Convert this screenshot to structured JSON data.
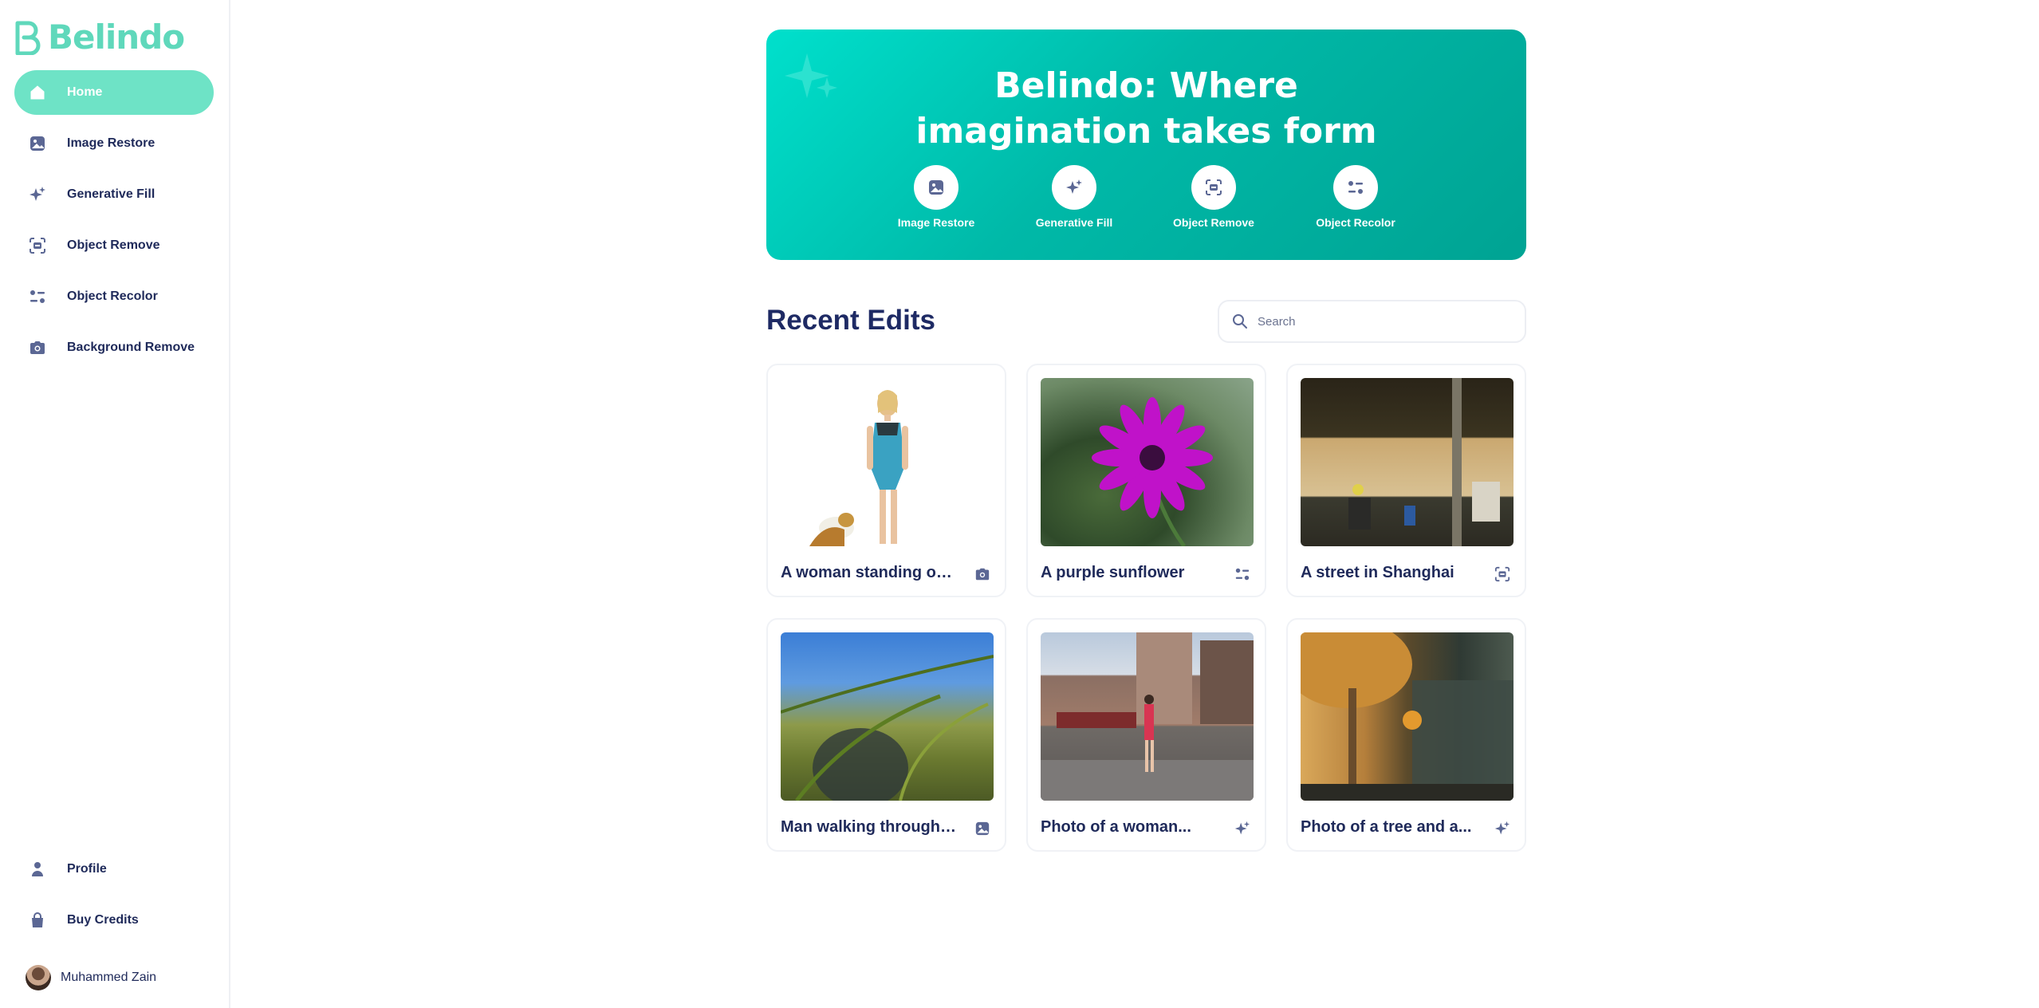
{
  "app": {
    "name": "Belindo",
    "brand_color": "#6ee3c6"
  },
  "sidebar": {
    "items": [
      {
        "label": "Home",
        "icon": "home-icon",
        "active": true
      },
      {
        "label": "Image Restore",
        "icon": "image-icon"
      },
      {
        "label": "Generative Fill",
        "icon": "sparkle-icon"
      },
      {
        "label": "Object Remove",
        "icon": "scan-icon"
      },
      {
        "label": "Object Recolor",
        "icon": "recolor-icon"
      },
      {
        "label": "Background Remove",
        "icon": "camera-icon"
      }
    ],
    "bottom_items": [
      {
        "label": "Profile",
        "icon": "user-icon"
      },
      {
        "label": "Buy Credits",
        "icon": "bag-icon"
      }
    ],
    "user": {
      "name": "Muhammed Zain"
    }
  },
  "hero": {
    "title_line1": "Belindo: Where",
    "title_line2": "imagination takes form",
    "actions": [
      {
        "label": "Image Restore",
        "icon": "image-icon"
      },
      {
        "label": "Generative Fill",
        "icon": "sparkle-icon"
      },
      {
        "label": "Object Remove",
        "icon": "scan-icon"
      },
      {
        "label": "Object Recolor",
        "icon": "recolor-icon"
      }
    ]
  },
  "recent": {
    "title": "Recent Edits",
    "search_placeholder": "Search",
    "cards": [
      {
        "title": "A woman standing on ...",
        "icon": "camera-icon"
      },
      {
        "title": "A purple sunflower",
        "icon": "recolor-icon"
      },
      {
        "title": "A street in Shanghai",
        "icon": "scan-icon"
      },
      {
        "title": "Man walking through t...",
        "icon": "image-icon"
      },
      {
        "title": "Photo of a woman...",
        "icon": "sparkle-icon"
      },
      {
        "title": "Photo of a tree and a...",
        "icon": "sparkle-icon"
      }
    ]
  }
}
